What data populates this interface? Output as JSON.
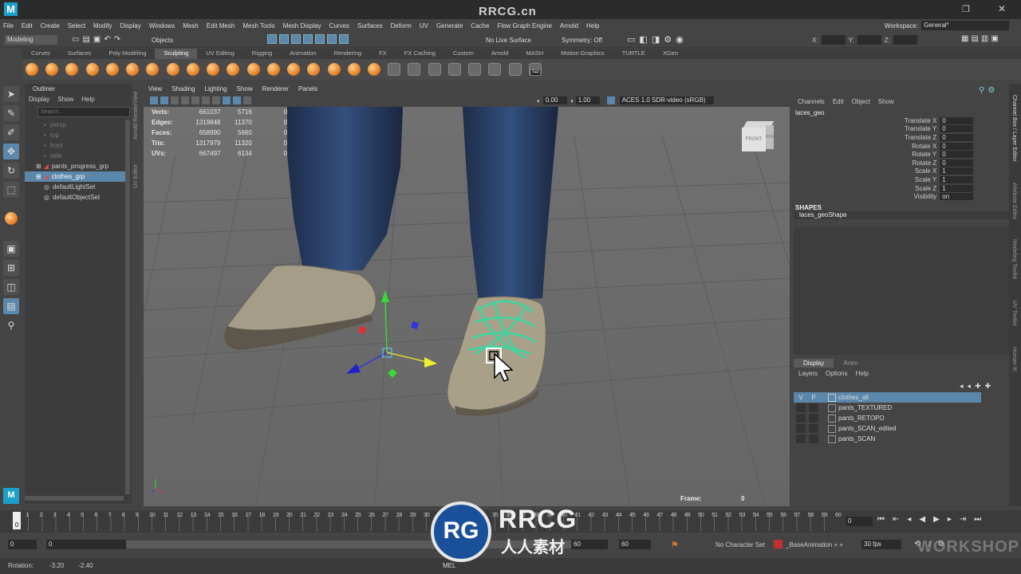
{
  "watermark": {
    "top": "RRCG.cn",
    "logo_text": "RRCG",
    "logo_sub": "人人素材",
    "corner": "WORKSHOP"
  },
  "menubar": [
    "File",
    "Edit",
    "Create",
    "Select",
    "Modify",
    "Display",
    "Windows",
    "Mesh",
    "Edit Mesh",
    "Mesh Tools",
    "Mesh Display",
    "Curves",
    "Surfaces",
    "Deform",
    "UV",
    "Generate",
    "Cache",
    "Flow Graph Engine",
    "Arnold",
    "Help"
  ],
  "workspace": {
    "label": "Workspace:",
    "value": "General*"
  },
  "status": {
    "mode": "Modeling",
    "objects": "Objects",
    "live_surface": "No Live Surface",
    "symmetry": "Symmetry: Off",
    "x": "X:",
    "y": "Y:",
    "z": "Z:"
  },
  "shelf_tabs": [
    "Curves",
    "Surfaces",
    "Poly Modeling",
    "Sculpting",
    "UV Editing",
    "Rigging",
    "Animation",
    "Rendering",
    "FX",
    "FX Caching",
    "Custom",
    "Arnold",
    "MASH",
    "Motion Graphics",
    "TURTLE",
    "XGen"
  ],
  "shelf_active": "Sculpting",
  "shelf_set_label": "Set",
  "outliner": {
    "title": "Outliner",
    "menu": [
      "Display",
      "Show",
      "Help"
    ],
    "search_placeholder": "Search...",
    "items": [
      {
        "label": "persp",
        "dim": true
      },
      {
        "label": "top",
        "dim": true
      },
      {
        "label": "front",
        "dim": true
      },
      {
        "label": "side",
        "dim": true
      },
      {
        "label": "pants_progress_grp",
        "dim": false
      },
      {
        "label": "clothes_grp",
        "dim": false,
        "selected": true
      },
      {
        "label": "defaultLightSet",
        "dim": false
      },
      {
        "label": "defaultObjectSet",
        "dim": false
      }
    ]
  },
  "side_labels": [
    "Arnold RenderView",
    "UV Editor"
  ],
  "viewport": {
    "menu": [
      "View",
      "Shading",
      "Lighting",
      "Show",
      "Renderer",
      "Panels"
    ],
    "exposure": "0.00",
    "gamma": "1.00",
    "colorspace": "ACES 1.0 SDR-video (sRGB)",
    "hud": [
      {
        "label": "Verts:",
        "a": "661037",
        "b": "5716",
        "c": "0"
      },
      {
        "label": "Edges:",
        "a": "1319848",
        "b": "11370",
        "c": "0"
      },
      {
        "label": "Faces:",
        "a": "658990",
        "b": "5660",
        "c": "0"
      },
      {
        "label": "Tris:",
        "a": "1317979",
        "b": "11320",
        "c": "0"
      },
      {
        "label": "UVs:",
        "a": "667497",
        "b": "6134",
        "c": "0"
      }
    ],
    "viewcube": {
      "front": "FRONT",
      "right": "RIGHT"
    },
    "frame_label": "Frame:",
    "frame_value": "0"
  },
  "channelbox": {
    "menu": [
      "Channels",
      "Edit",
      "Object",
      "Show"
    ],
    "object": "laces_geo",
    "channels": [
      {
        "label": "Translate X",
        "value": "0"
      },
      {
        "label": "Translate Y",
        "value": "0"
      },
      {
        "label": "Translate Z",
        "value": "0"
      },
      {
        "label": "Rotate X",
        "value": "0"
      },
      {
        "label": "Rotate Y",
        "value": "0"
      },
      {
        "label": "Rotate Z",
        "value": "0"
      },
      {
        "label": "Scale X",
        "value": "1"
      },
      {
        "label": "Scale Y",
        "value": "1"
      },
      {
        "label": "Scale Z",
        "value": "1"
      },
      {
        "label": "Visibility",
        "value": "on"
      }
    ],
    "shapes_header": "SHAPES",
    "shape": "laces_geoShape"
  },
  "layers": {
    "tabs": [
      "Display",
      "Anim"
    ],
    "menu": [
      "Layers",
      "Options",
      "Help"
    ],
    "items": [
      {
        "v": "V",
        "p": "P",
        "label": "clothes_all",
        "selected": true
      },
      {
        "v": "",
        "p": "",
        "label": "pants_TEXTURED",
        "selected": false
      },
      {
        "v": "",
        "p": "",
        "label": "pants_RETOPO",
        "selected": false
      },
      {
        "v": "",
        "p": "",
        "label": "pants_SCAN_edited",
        "selected": false
      },
      {
        "v": "",
        "p": "",
        "label": "pants_SCAN",
        "selected": false
      }
    ]
  },
  "vertical_tabs": [
    "Channel Box / Layer Editor",
    "Attribute Editor",
    "Modeling Toolkit",
    "UV Toolkit",
    "Human IK"
  ],
  "timeline": {
    "ticks": [
      "0",
      "1",
      "2",
      "3",
      "4",
      "5",
      "6",
      "7",
      "8",
      "9",
      "10",
      "11",
      "12",
      "13",
      "14",
      "15",
      "16",
      "17",
      "18",
      "19",
      "20",
      "21",
      "22",
      "23",
      "24",
      "25",
      "26",
      "27",
      "28",
      "29",
      "30",
      "31",
      "32",
      "33",
      "34",
      "35",
      "36",
      "37",
      "38",
      "39",
      "40",
      "41",
      "42",
      "43",
      "44",
      "45",
      "46",
      "47",
      "48",
      "49",
      "50",
      "51",
      "52",
      "53",
      "54",
      "55",
      "56",
      "57",
      "58",
      "59",
      "60"
    ],
    "current": "0",
    "current_field": "0"
  },
  "range": {
    "start": "0",
    "inner_start": "0",
    "inner_end": "60",
    "end": "60",
    "char_set": "No Character Set",
    "anim_layer": "_BaseAnimation + +",
    "fps": "30 fps"
  },
  "cmdline": {
    "rotation_label": "Rotation:",
    "rot_a": "-3.20",
    "rot_b": "-2.40",
    "mel": "MEL"
  }
}
